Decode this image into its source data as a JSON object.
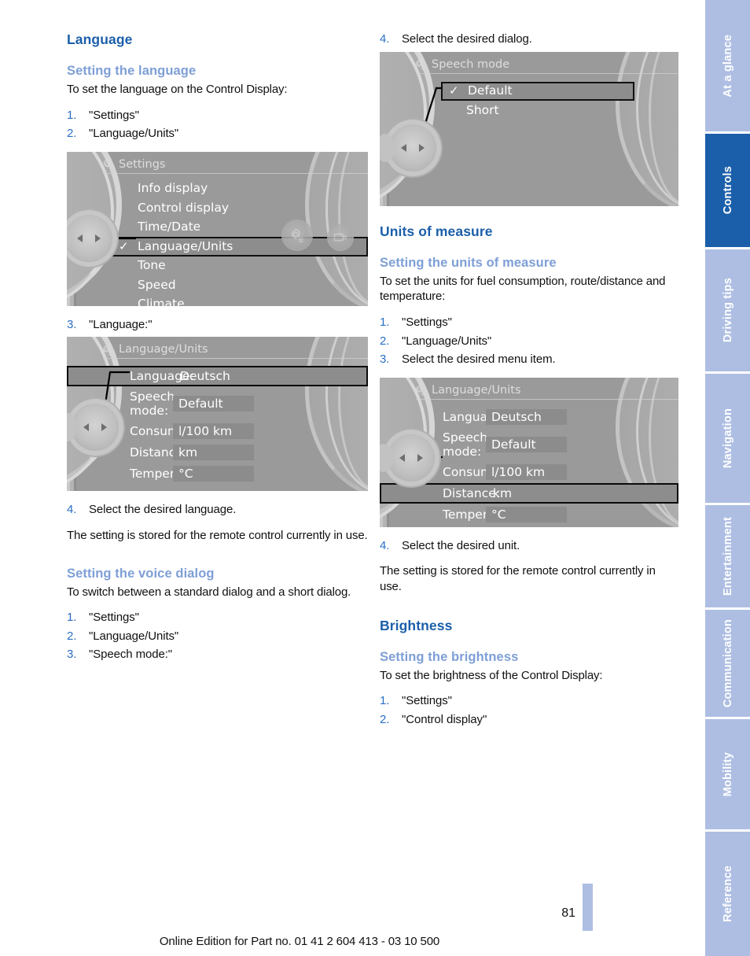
{
  "page": {
    "number": "81",
    "footer_text": "Online Edition for Part no. 01 41 2 604 413 - 03 10 500"
  },
  "tabs": [
    {
      "label": "At a glance",
      "active": false
    },
    {
      "label": "Controls",
      "active": true
    },
    {
      "label": "Driving tips",
      "active": false
    },
    {
      "label": "Navigation",
      "active": false
    },
    {
      "label": "Entertainment",
      "active": false
    },
    {
      "label": "Communication",
      "active": false
    },
    {
      "label": "Mobility",
      "active": false
    },
    {
      "label": "Reference",
      "active": false
    }
  ],
  "left_column": {
    "section_title": "Language",
    "sub1_title": "Setting the language",
    "sub1_intro": "To set the language on the Control Display:",
    "sub1_steps": [
      {
        "num": "1.",
        "text": "\"Settings\""
      },
      {
        "num": "2.",
        "text": "\"Language/Units\""
      }
    ],
    "step3": {
      "num": "3.",
      "text": "\"Language:\""
    },
    "step4": {
      "num": "4.",
      "text": "Select the desired language."
    },
    "stored_note": "The setting is stored for the remote control currently in use.",
    "sub2_title": "Setting the voice dialog",
    "sub2_intro": "To switch between a standard dialog and a short dialog.",
    "sub2_steps": [
      {
        "num": "1.",
        "text": "\"Settings\""
      },
      {
        "num": "2.",
        "text": "\"Language/Units\""
      },
      {
        "num": "3.",
        "text": "\"Speech mode:\""
      }
    ]
  },
  "right_column": {
    "step4_dialog": {
      "num": "4.",
      "text": "Select the desired dialog."
    },
    "section_title": "Units of measure",
    "sub1_title": "Setting the units of measure",
    "sub1_intro": "To set the units for fuel consumption, route/distance and temperature:",
    "sub1_steps": [
      {
        "num": "1.",
        "text": "\"Settings\""
      },
      {
        "num": "2.",
        "text": "\"Language/Units\""
      },
      {
        "num": "3.",
        "text": "Select the desired menu item."
      }
    ],
    "step4_unit": {
      "num": "4.",
      "text": "Select the desired unit."
    },
    "stored_note": "The setting is stored for the remote control currently in use.",
    "section2_title": "Brightness",
    "sub2_title": "Setting the brightness",
    "sub2_intro": "To set the brightness of the Control Display:",
    "sub2_steps": [
      {
        "num": "1.",
        "text": "\"Settings\""
      },
      {
        "num": "2.",
        "text": "\"Control display\""
      }
    ]
  },
  "screens": {
    "settings": {
      "title": "Settings",
      "items": [
        {
          "label": "Info display",
          "checked": false,
          "selected": false
        },
        {
          "label": "Control display",
          "checked": false,
          "selected": false
        },
        {
          "label": "Time/Date",
          "checked": false,
          "selected": false
        },
        {
          "label": "Language/Units",
          "checked": true,
          "selected": true
        },
        {
          "label": "Tone",
          "checked": false,
          "selected": false
        },
        {
          "label": "Speed",
          "checked": false,
          "selected": false
        },
        {
          "label": "Climate",
          "checked": false,
          "selected": false
        }
      ]
    },
    "language_units_1": {
      "title": "Language/Units",
      "rows": [
        {
          "key": "Language:",
          "value": "Deutsch",
          "selected": true
        },
        {
          "key": "Speech mode:",
          "value": "Default",
          "selected": false
        },
        {
          "key": "Consumption:",
          "value": "l/100 km",
          "selected": false
        },
        {
          "key": "Distance:",
          "value": "km",
          "selected": false
        },
        {
          "key": "Temperature:",
          "value": "°C",
          "selected": false
        }
      ]
    },
    "speech_mode": {
      "title": "Speech mode",
      "items": [
        {
          "label": "Default",
          "checked": true,
          "selected": true
        },
        {
          "label": "Short",
          "checked": false,
          "selected": false
        }
      ]
    },
    "language_units_2": {
      "title": "Language/Units",
      "rows": [
        {
          "key": "Language:",
          "value": "Deutsch",
          "selected": false
        },
        {
          "key": "Speech mode:",
          "value": "Default",
          "selected": false
        },
        {
          "key": "Consumption:",
          "value": "l/100 km",
          "selected": false
        },
        {
          "key": "Distance:",
          "value": "km",
          "selected": true
        },
        {
          "key": "Temperature:",
          "value": "°C",
          "selected": false
        }
      ]
    }
  },
  "colors": {
    "heading_blue": "#1b5faa",
    "subheading_blue": "#7e9fd6",
    "step_number_blue": "#2a6fc4",
    "tab_inactive": "#aebee3",
    "tab_active": "#1b5faa",
    "screen_bg": "#9a9a9a"
  }
}
